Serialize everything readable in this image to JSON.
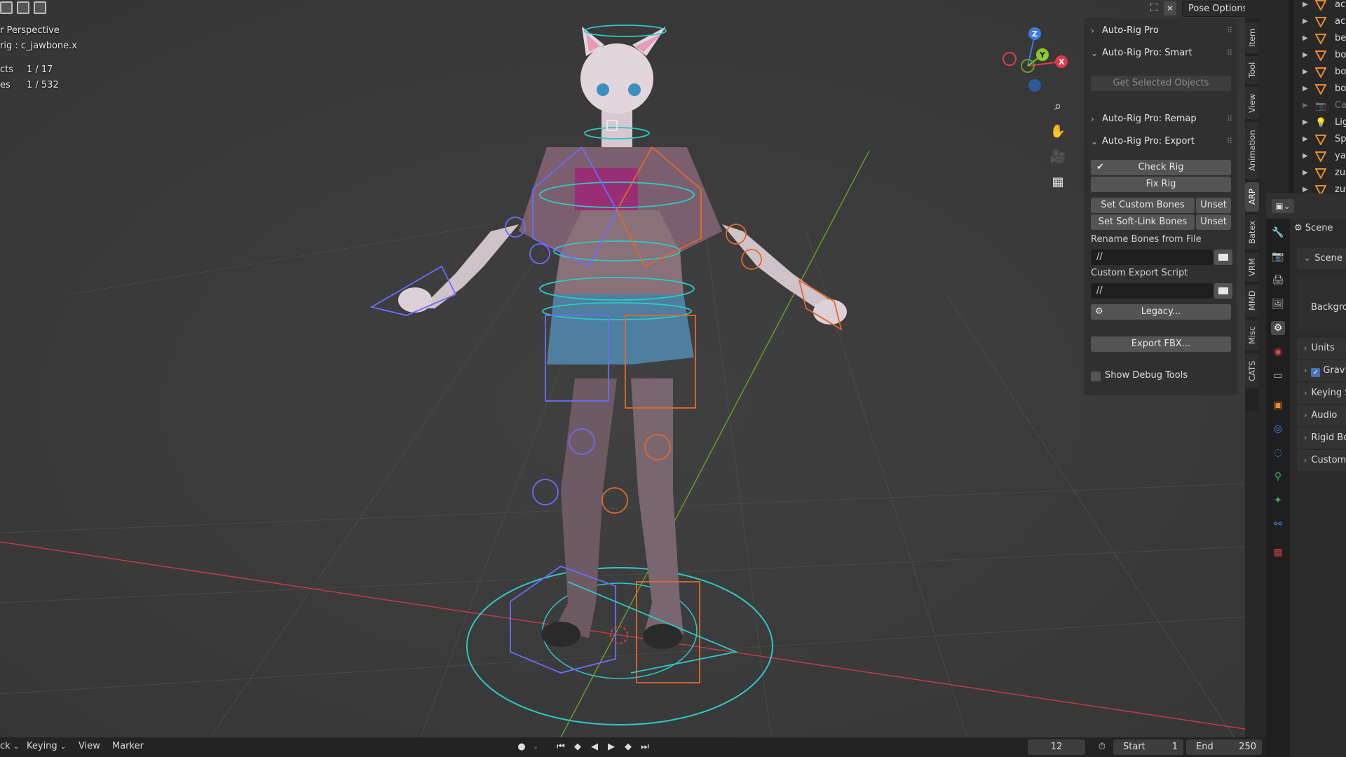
{
  "viewport": {
    "overlay": {
      "view_name": "r Perspective",
      "active_object": "rig : c_jawbone.x",
      "stats": [
        {
          "label": "cts",
          "value": "1 / 17"
        },
        {
          "label": "es",
          "value": "1 / 532"
        }
      ]
    },
    "pose_options_label": "Pose Options",
    "axis_labels": {
      "x": "X",
      "y": "Y",
      "z": "Z"
    },
    "nav_buttons": [
      "zoom-icon",
      "hand-pan-icon",
      "camera-icon",
      "grid-icon"
    ]
  },
  "npanel": {
    "sections": {
      "arp": "Auto-Rig Pro",
      "smart": "Auto-Rig Pro: Smart",
      "remap": "Auto-Rig Pro: Remap",
      "export": "Auto-Rig Pro: Export"
    },
    "get_selected": "Get Selected Objects",
    "check_rig": "Check Rig",
    "fix_rig": "Fix Rig",
    "set_custom_bones": "Set Custom Bones",
    "set_softlink_bones": "Set Soft-Link Bones",
    "unset": "Unset",
    "rename_bones_label": "Rename Bones from File",
    "rename_bones_path": "//",
    "custom_export_label": "Custom Export Script",
    "custom_export_path": "//",
    "legacy": "Legacy...",
    "export_fbx": "Export FBX...",
    "show_debug": "Show Debug Tools"
  },
  "sidetabs": [
    "Item",
    "Tool",
    "View",
    "Animation",
    "ARP",
    "Batex",
    "VRM",
    "MMD",
    "Misc",
    "CATS"
  ],
  "outliner": {
    "items": [
      "ac",
      "ac",
      "be",
      "bo",
      "bo",
      "bo",
      "Ca",
      "Lig",
      "Sp",
      "ya",
      "zu",
      "zu"
    ]
  },
  "properties": {
    "header": "Scene",
    "panel": "Scene",
    "background_label": "Backgro",
    "rows": [
      "Units",
      "Grav",
      "Keying S",
      "Audio",
      "Rigid Bo",
      "Custom"
    ]
  },
  "timeline": {
    "menu": [
      "ck",
      "Keying",
      "View",
      "Marker"
    ],
    "current_frame": "12",
    "start_label": "Start",
    "start": "1",
    "end_label": "End",
    "end": "250"
  },
  "colors": {
    "accent": "#4772b3",
    "x_axis": "#e03a4a",
    "y_axis": "#8bcb2b",
    "z_axis": "#3d7be0",
    "bone_cyan": "#2fc7c7",
    "bone_blue": "#6b6bff",
    "bone_orange": "#e06a2a"
  }
}
